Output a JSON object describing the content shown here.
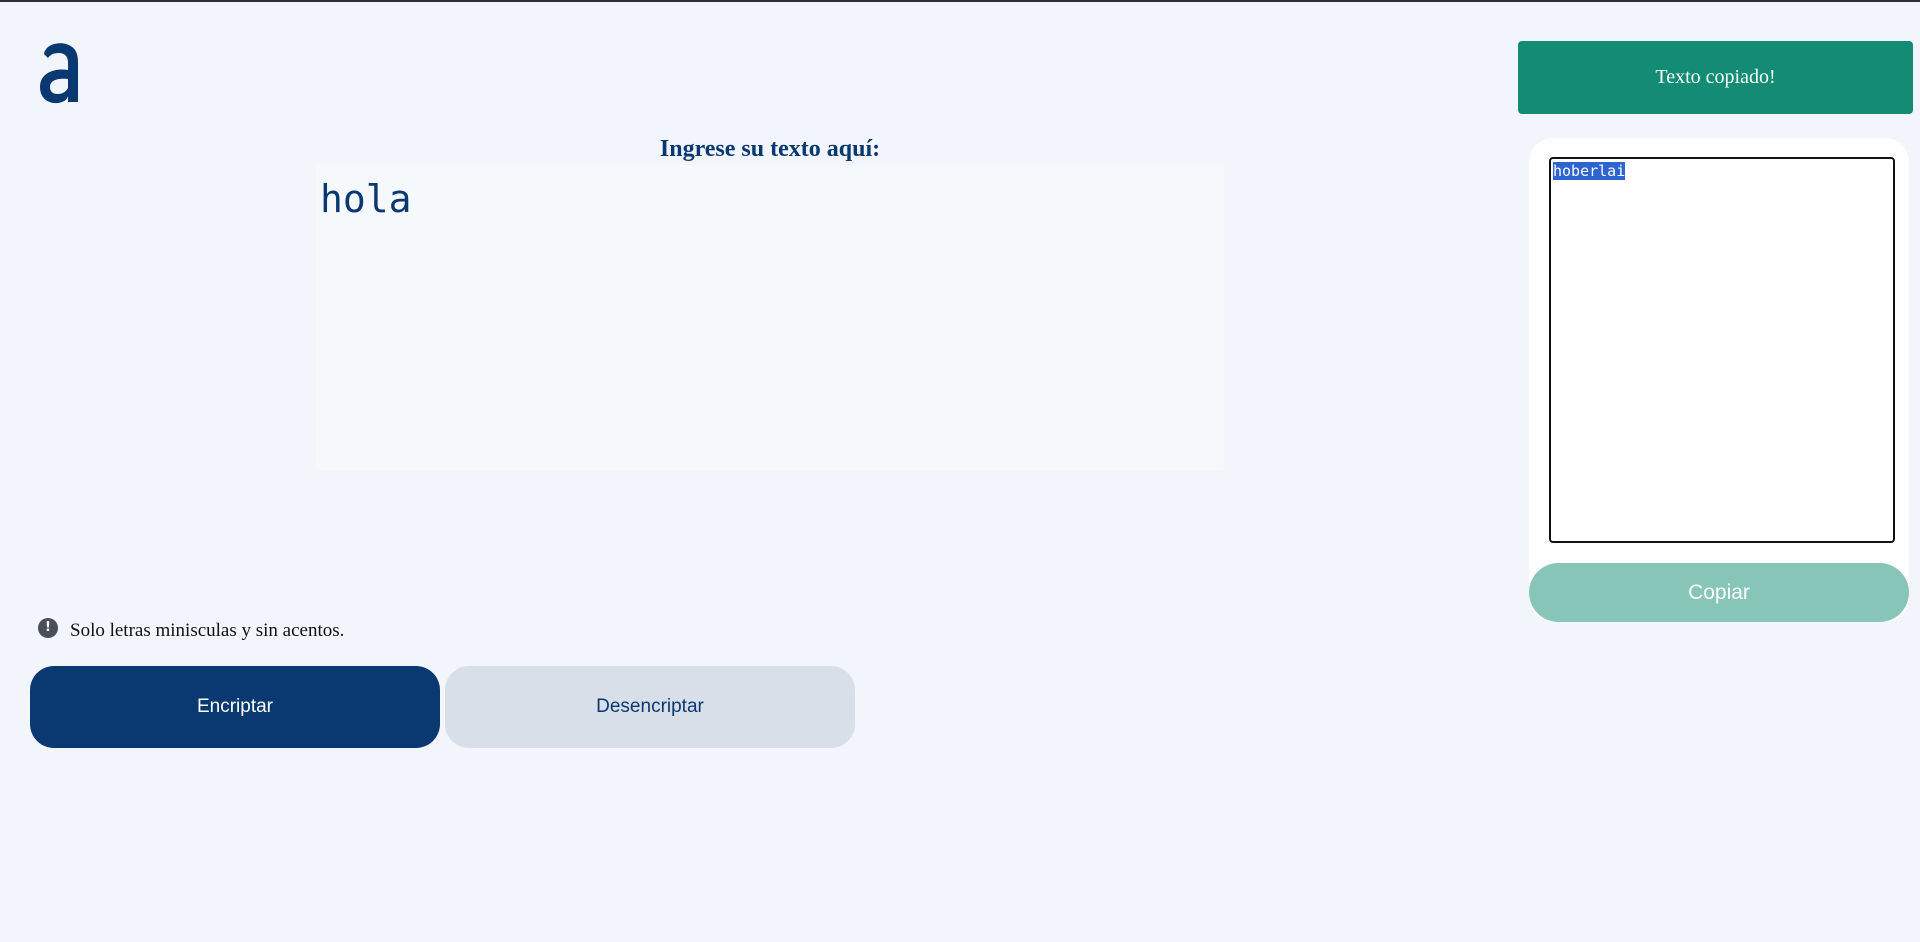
{
  "header": {
    "logo_icon": "alura-a-logo"
  },
  "editor": {
    "title": "Ingrese su texto aquí:",
    "input_value": "hola"
  },
  "notice": {
    "icon": "exclamation-circle-icon",
    "text": "Solo letras minisculas y sin acentos."
  },
  "actions": {
    "encrypt_label": "Encriptar",
    "decrypt_label": "Desencriptar"
  },
  "toast": {
    "message": "Texto copiado!"
  },
  "output": {
    "value": "hoberlai",
    "copy_label": "Copiar"
  },
  "colors": {
    "primary": "#0a3871",
    "background": "#f2f5fc",
    "toast": "#138b75",
    "copy_button": "#86c5b7",
    "secondary_button": "#d8dfe8"
  }
}
